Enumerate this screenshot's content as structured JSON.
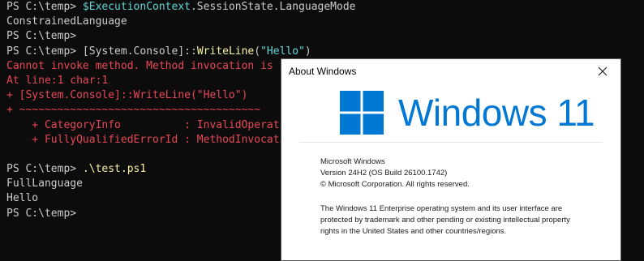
{
  "terminal": {
    "lines": [
      {
        "prompt": "PS C:\\temp> ",
        "var": "$ExecutionContext",
        "rest": ".SessionState.LanguageMode"
      },
      {
        "text": "ConstrainedLanguage"
      },
      {
        "prompt": "PS C:\\temp> "
      },
      {
        "prompt": "PS C:\\temp> ",
        "type": "[System.Console]",
        "sep": "::",
        "method": "WriteLine",
        "open": "(",
        "arg": "\"Hello\"",
        "close": ")"
      },
      {
        "error": "Cannot invoke method. Method invocation is supported only on core types in this language mode."
      },
      {
        "error": "At line:1 char:1"
      },
      {
        "error": "+ [System.Console]::WriteLine(\"Hello\")"
      },
      {
        "error": "+ ~~~~~~~~~~~~~~~~~~~~~~~~~~~~~~~~~~~~~~"
      },
      {
        "error": "    + CategoryInfo          : InvalidOperation: (:) [], RuntimeException"
      },
      {
        "error": "    + FullyQualifiedErrorId : MethodInvocationNotSupportedInConstrainedLanguage"
      },
      {
        "text": ""
      },
      {
        "prompt": "PS C:\\temp> ",
        "cmd": ".\\test.ps1"
      },
      {
        "text": "FullLanguage"
      },
      {
        "text": "Hello"
      },
      {
        "prompt": "PS C:\\temp> "
      }
    ]
  },
  "dialog": {
    "title": "About Windows",
    "close_icon": "close-icon",
    "logo_text": "Windows 11",
    "logo_color": "#0078d4",
    "info": [
      "Microsoft Windows",
      "Version 24H2 (OS Build 26100.1742)",
      "© Microsoft Corporation. All rights reserved."
    ],
    "paragraph": [
      "The Windows 11 Enterprise operating system and its user interface are",
      "protected by trademark and other pending or existing intellectual property",
      "rights in the United States and other countries/regions."
    ]
  }
}
